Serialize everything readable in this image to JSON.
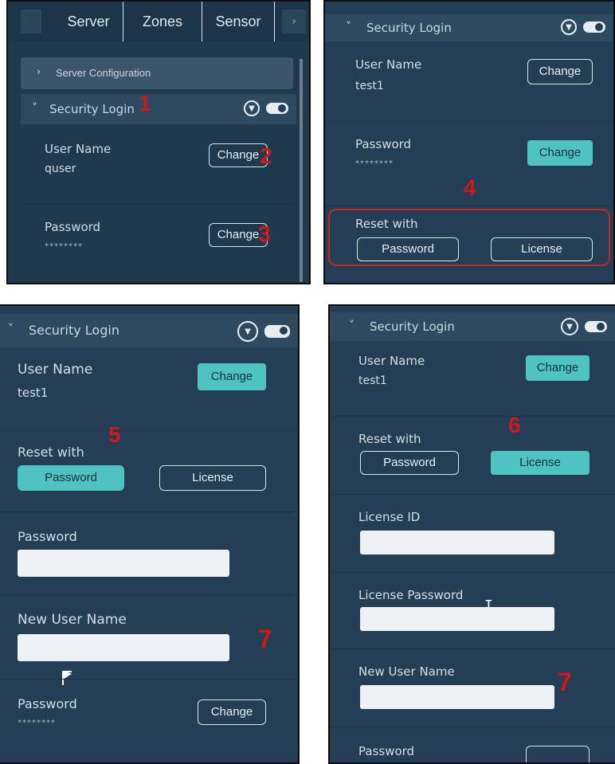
{
  "p1": {
    "tabs": [
      "Server",
      "Zones",
      "Sensor"
    ],
    "server_configuration": "Server Configuration",
    "section_title": "Security Login",
    "user_name_label": "User Name",
    "user_name_value": "quser",
    "password_label": "Password",
    "password_value": "********",
    "change_label": "Change",
    "marks": [
      "1",
      "2",
      "3"
    ]
  },
  "p2": {
    "section_title": "Security Login",
    "user_name_label": "User Name",
    "user_name_value": "test1",
    "password_label": "Password",
    "password_value": "********",
    "change_label": "Change",
    "reset_label": "Reset with",
    "reset_password": "Password",
    "reset_license": "License",
    "mark": "4"
  },
  "p3": {
    "section_title": "Security Login",
    "user_name_label": "User Name",
    "user_name_value": "test1",
    "change_label": "Change",
    "reset_label": "Reset with",
    "reset_password": "Password",
    "reset_license": "License",
    "password_label": "Password",
    "new_user_label": "New User Name",
    "bottom_password_label": "Password",
    "bottom_password_value": "********",
    "marks": [
      "5",
      "7"
    ]
  },
  "p4": {
    "section_title": "Security Login",
    "user_name_label": "User Name",
    "user_name_value": "test1",
    "change_label": "Change",
    "reset_label": "Reset with",
    "reset_password": "Password",
    "reset_license": "License",
    "license_id_label": "License ID",
    "license_password_label": "License Password",
    "new_user_label": "New User Name",
    "bottom_password_label": "Password",
    "marks": [
      "6",
      "7"
    ]
  },
  "colors": {
    "panel": "#243f55",
    "accent": "#4fc3c1",
    "annotation": "#d01818"
  }
}
